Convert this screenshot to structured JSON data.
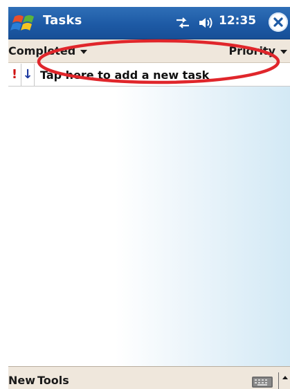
{
  "titlebar": {
    "app_title": "Tasks",
    "clock": "12:35",
    "start_icon": "windows-flag-icon",
    "connectivity_icon": "connectivity-icon",
    "volume_icon": "speaker-icon",
    "close_icon": "close-icon"
  },
  "filterbar": {
    "filter_label": "Completed",
    "sort_label": "Priority"
  },
  "entrybar": {
    "priority_glyph": "!",
    "sort_glyph": "↓",
    "placeholder": "Tap here to add a new task",
    "highlight_color": "#e0262b"
  },
  "tasks": [],
  "menubar": {
    "new_label": "New",
    "tools_label": "Tools",
    "keyboard_icon": "keyboard-icon",
    "input_arrow_icon": "input-arrow-icon"
  },
  "colors": {
    "titlebar": "#1d5aa5",
    "bars": "#efe7dc",
    "priority": "#d01313",
    "sort_arrow": "#1d3aa0"
  }
}
